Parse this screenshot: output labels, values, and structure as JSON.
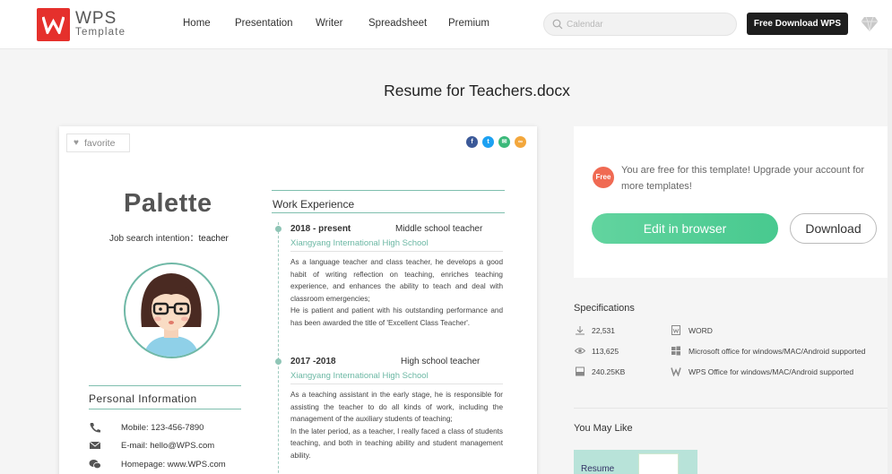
{
  "header": {
    "logo_main": "WPS",
    "logo_sub": "Template",
    "nav": [
      "Home",
      "Presentation",
      "Writer",
      "Spreadsheet",
      "Premium"
    ],
    "search_placeholder": "Calendar",
    "download_label": "Free Download WPS"
  },
  "page": {
    "title": "Resume for Teachers.docx"
  },
  "preview": {
    "favorite_label": "favorite",
    "share_icons": [
      "facebook-icon",
      "twitter-icon",
      "email-icon",
      "link-icon"
    ],
    "resume": {
      "name": "Palette",
      "intent_label": "Job search intention：",
      "intent_value": "teacher",
      "personal_info_heading": "Personal Information",
      "contacts": [
        {
          "icon": "phone-icon",
          "text": "Mobile: 123-456-7890"
        },
        {
          "icon": "mail-icon",
          "text": "E-mail: hello@WPS.com"
        },
        {
          "icon": "wechat-icon",
          "text": "Homepage: www.WPS.com"
        }
      ],
      "work_heading": "Work Experience",
      "jobs": [
        {
          "date": "2018 - present",
          "title": "Middle school teacher",
          "school": "Xiangyang International High School",
          "desc": [
            "As a language teacher and class teacher, he develops a good habit of writing reflection on teaching, enriches teaching experience, and enhances the ability to teach and deal with classroom emergencies;",
            "He is patient and patient with his outstanding performance and has been awarded the title of 'Excellent Class Teacher'."
          ]
        },
        {
          "date": "2017 -2018",
          "title": "High school teacher",
          "school": "Xiangyang International High School",
          "desc": [
            "As a teaching assistant in the early stage, he is responsible for assisting the teacher to do all kinds of work, including the management of the auxiliary students of teaching;",
            "In the later period, as a teacher, I really faced a class of students teaching, and both in teaching ability and student management ability."
          ]
        }
      ]
    }
  },
  "sidebar": {
    "free_badge": "Free",
    "free_message": "You are free for this template! Upgrade your account for more templates!",
    "edit_label": "Edit in browser",
    "download_label": "Download",
    "spec_title": "Specifications",
    "specs_left": [
      {
        "icon": "download-count-icon",
        "text": "22,531"
      },
      {
        "icon": "eye-icon",
        "text": "113,625"
      },
      {
        "icon": "file-size-icon",
        "text": "240.25KB"
      }
    ],
    "specs_right": [
      {
        "icon": "word-file-icon",
        "text": "WORD"
      },
      {
        "icon": "windows-icon",
        "text": "Microsoft office for windows/MAC/Android supported"
      },
      {
        "icon": "wps-icon",
        "text": "WPS Office for windows/MAC/Android supported"
      }
    ],
    "you_may_like": "You May Like",
    "thumb_label": "Resume"
  },
  "colors": {
    "accent": "#e5302c",
    "green": "#52cc95",
    "teal": "#6cb8a4"
  }
}
